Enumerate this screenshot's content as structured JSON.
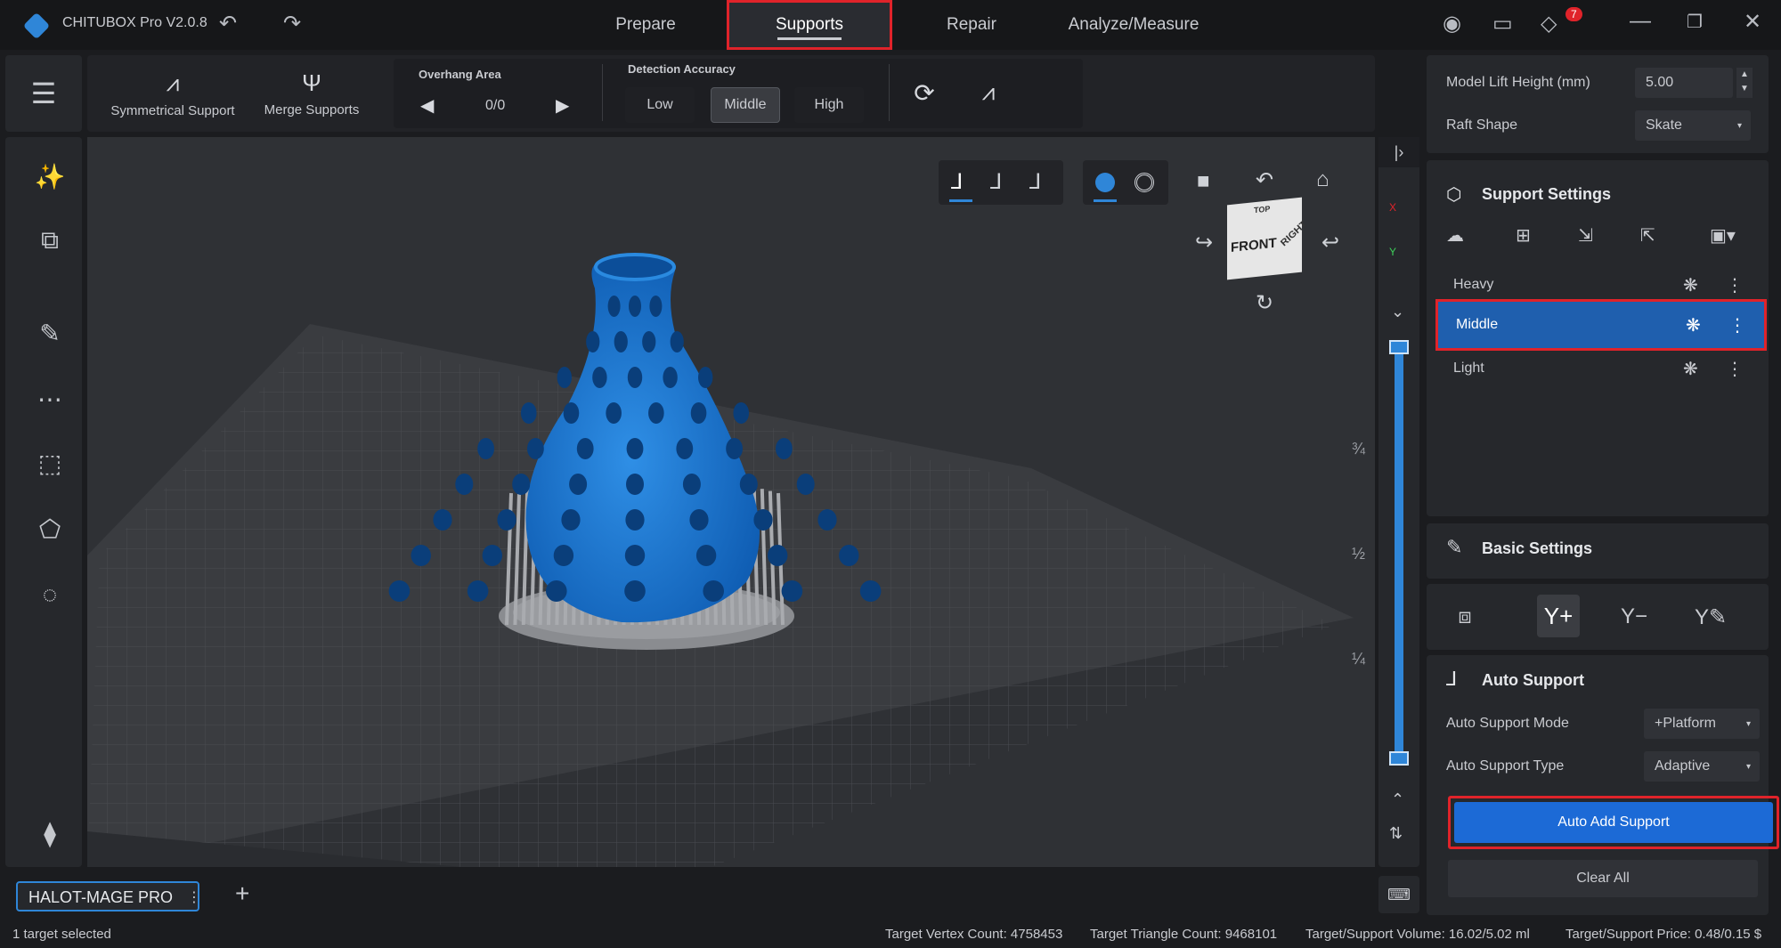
{
  "app": {
    "title": "CHITUBOX Pro V2.0.8",
    "notification_count": "7"
  },
  "nav": {
    "tabs": [
      "Prepare",
      "Supports",
      "Repair",
      "Analyze/Measure"
    ],
    "active": "Supports"
  },
  "toolbar": {
    "symmetrical_support": "Symmetrical Support",
    "merge_supports": "Merge Supports",
    "overhang_area_label": "Overhang Area",
    "overhang_count": "0/0",
    "detection_accuracy_label": "Detection Accuracy",
    "accuracy_options": [
      "Low",
      "Middle",
      "High"
    ],
    "accuracy_selected": "Middle"
  },
  "viewport": {
    "view_cube": {
      "top": "TOP",
      "front": "FRONT",
      "right": "RIGHT"
    },
    "axis_x": "X",
    "axis_y": "Y",
    "layer_marks": [
      "¾",
      "½",
      "¼"
    ],
    "model_color": "#1f78d1"
  },
  "right_panel": {
    "model_lift_height_label": "Model Lift Height (mm)",
    "model_lift_height_value": "5.00",
    "raft_shape_label": "Raft Shape",
    "raft_shape_value": "Skate",
    "support_settings_title": "Support Settings",
    "presets": [
      "Heavy",
      "Middle",
      "Light"
    ],
    "preset_selected": "Middle",
    "basic_settings_title": "Basic Settings",
    "auto_support_title": "Auto Support",
    "auto_support_mode_label": "Auto Support Mode",
    "auto_support_mode_value": "+Platform",
    "auto_support_type_label": "Auto Support Type",
    "auto_support_type_value": "Adaptive",
    "auto_add_support_button": "Auto Add Support",
    "clear_all_button": "Clear All"
  },
  "printer_tab": {
    "name": "HALOT-MAGE PRO"
  },
  "status": {
    "selection": "1 target selected",
    "vertex_count": "Target Vertex Count: 4758453",
    "triangle_count": "Target Triangle Count: 9468101",
    "volume": "Target/Support Volume: 16.02/5.02  ml",
    "price": "Target/Support Price: 0.48/0.15  $"
  },
  "colors": {
    "accent": "#1c6ad6",
    "highlight_box": "#e0232a",
    "selected_preset": "#1f5fae"
  }
}
